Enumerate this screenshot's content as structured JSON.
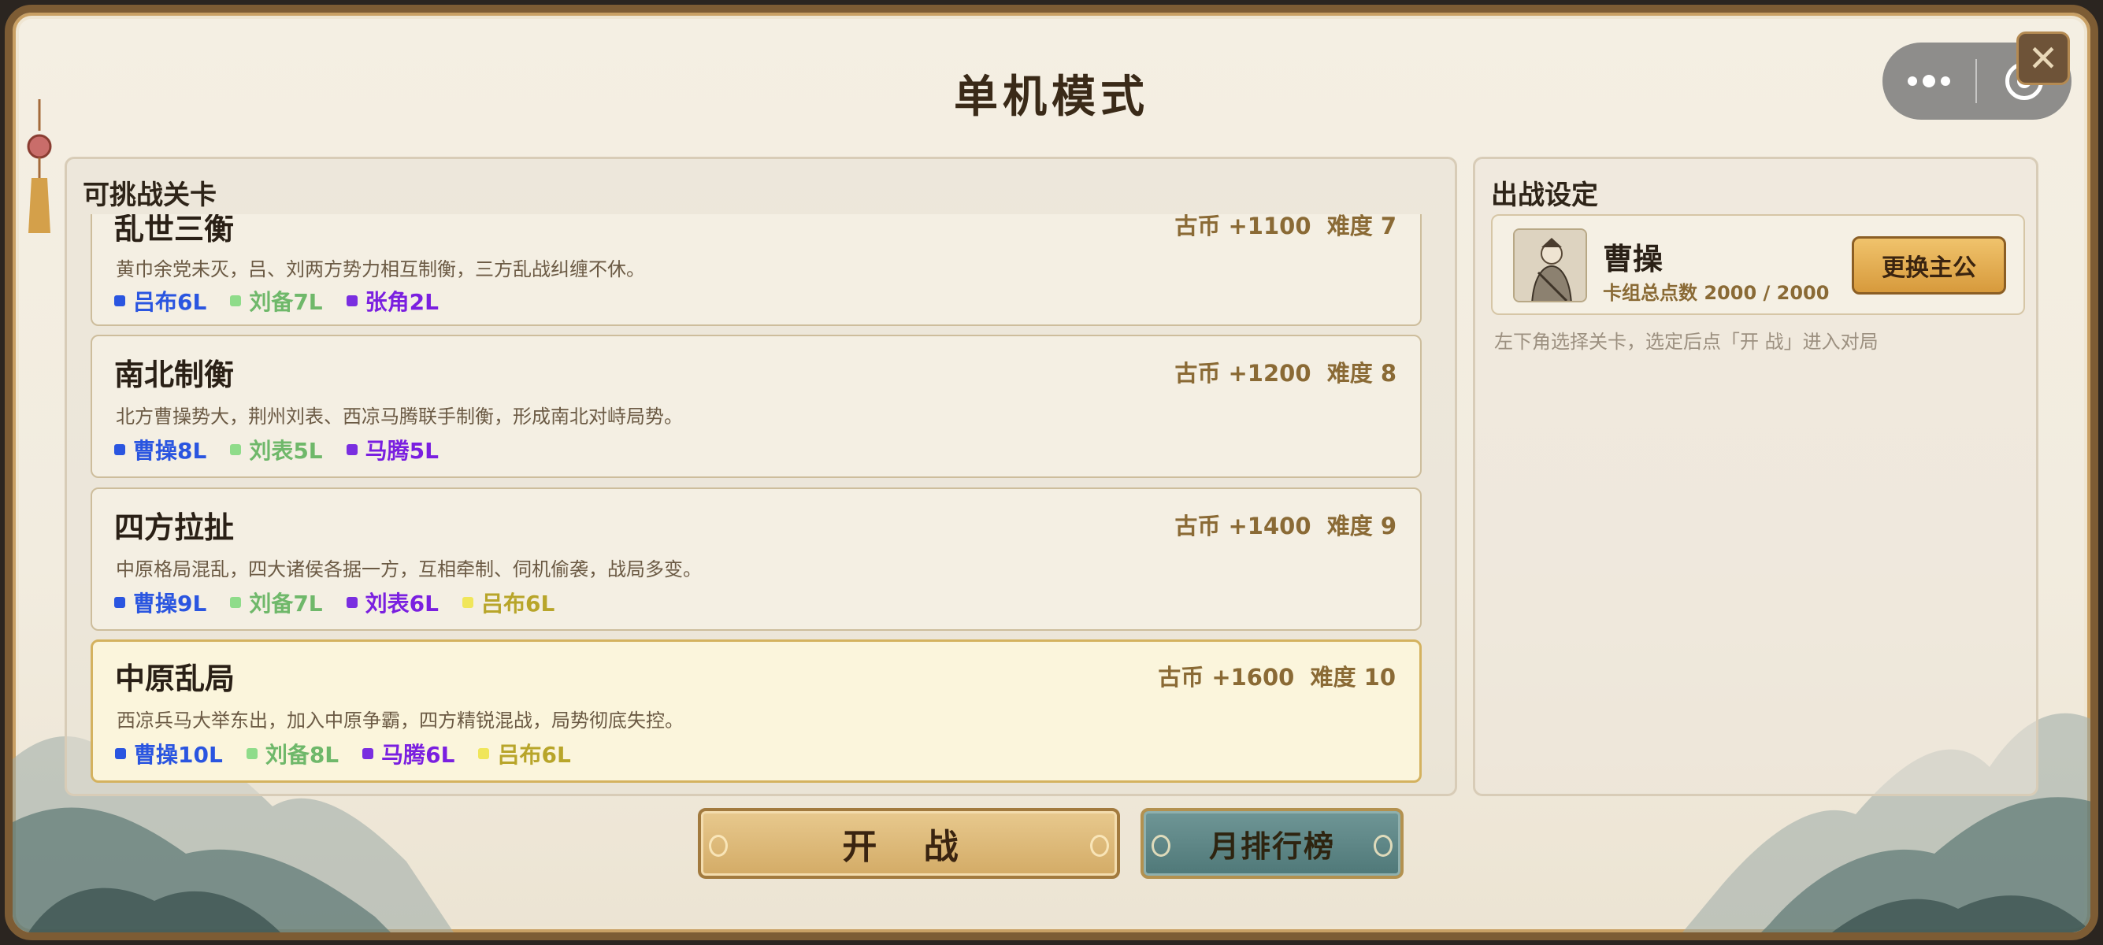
{
  "title": "单机模式",
  "left_panel": {
    "title": "可挑战关卡"
  },
  "levels": [
    {
      "name": "乱世三衡",
      "reward": "古币 +1100",
      "difficulty": "难度 7",
      "desc": "黄巾余党未灭，吕、刘两方势力相互制衡，三方乱战纠缠不休。",
      "tags": [
        {
          "label": "吕布6L",
          "color": "#2a55e0"
        },
        {
          "label": "刘备7L",
          "color": "#8fdc8a"
        },
        {
          "label": "张角2L",
          "color": "#7a2ee0"
        }
      ]
    },
    {
      "name": "南北制衡",
      "reward": "古币 +1200",
      "difficulty": "难度 8",
      "desc": "北方曹操势大，荆州刘表、西凉马腾联手制衡，形成南北对峙局势。",
      "tags": [
        {
          "label": "曹操8L",
          "color": "#2a55e0"
        },
        {
          "label": "刘表5L",
          "color": "#8fdc8a"
        },
        {
          "label": "马腾5L",
          "color": "#7a2ee0"
        }
      ]
    },
    {
      "name": "四方拉扯",
      "reward": "古币 +1400",
      "difficulty": "难度 9",
      "desc": "中原格局混乱，四大诸侯各据一方，互相牵制、伺机偷袭，战局多变。",
      "tags": [
        {
          "label": "曹操9L",
          "color": "#2a55e0"
        },
        {
          "label": "刘备7L",
          "color": "#8fdc8a"
        },
        {
          "label": "刘表6L",
          "color": "#7a2ee0"
        },
        {
          "label": "吕布6L",
          "color": "#f0e65a"
        }
      ]
    },
    {
      "name": "中原乱局",
      "reward": "古币 +1600",
      "difficulty": "难度 10",
      "desc": "西凉兵马大举东出，加入中原争霸，四方精锐混战，局势彻底失控。",
      "selected": true,
      "tags": [
        {
          "label": "曹操10L",
          "color": "#2a55e0"
        },
        {
          "label": "刘备8L",
          "color": "#8fdc8a"
        },
        {
          "label": "马腾6L",
          "color": "#7a2ee0"
        },
        {
          "label": "吕布6L",
          "color": "#f0e65a"
        }
      ]
    }
  ],
  "right_panel": {
    "title": "出战设定",
    "lord_name": "曹操",
    "deck_points": "卡组总点数 2000 / 2000",
    "change_button": "更换主公",
    "hint": "左下角选择关卡，选定后点「开 战」进入对局"
  },
  "buttons": {
    "start": "开 战",
    "ranking": "月排行榜"
  },
  "tag_text_colors": {
    "blue": "#2a55e0",
    "green": "#6fb86a",
    "purple": "#7a1fe0",
    "yellow": "#b8a52a"
  }
}
